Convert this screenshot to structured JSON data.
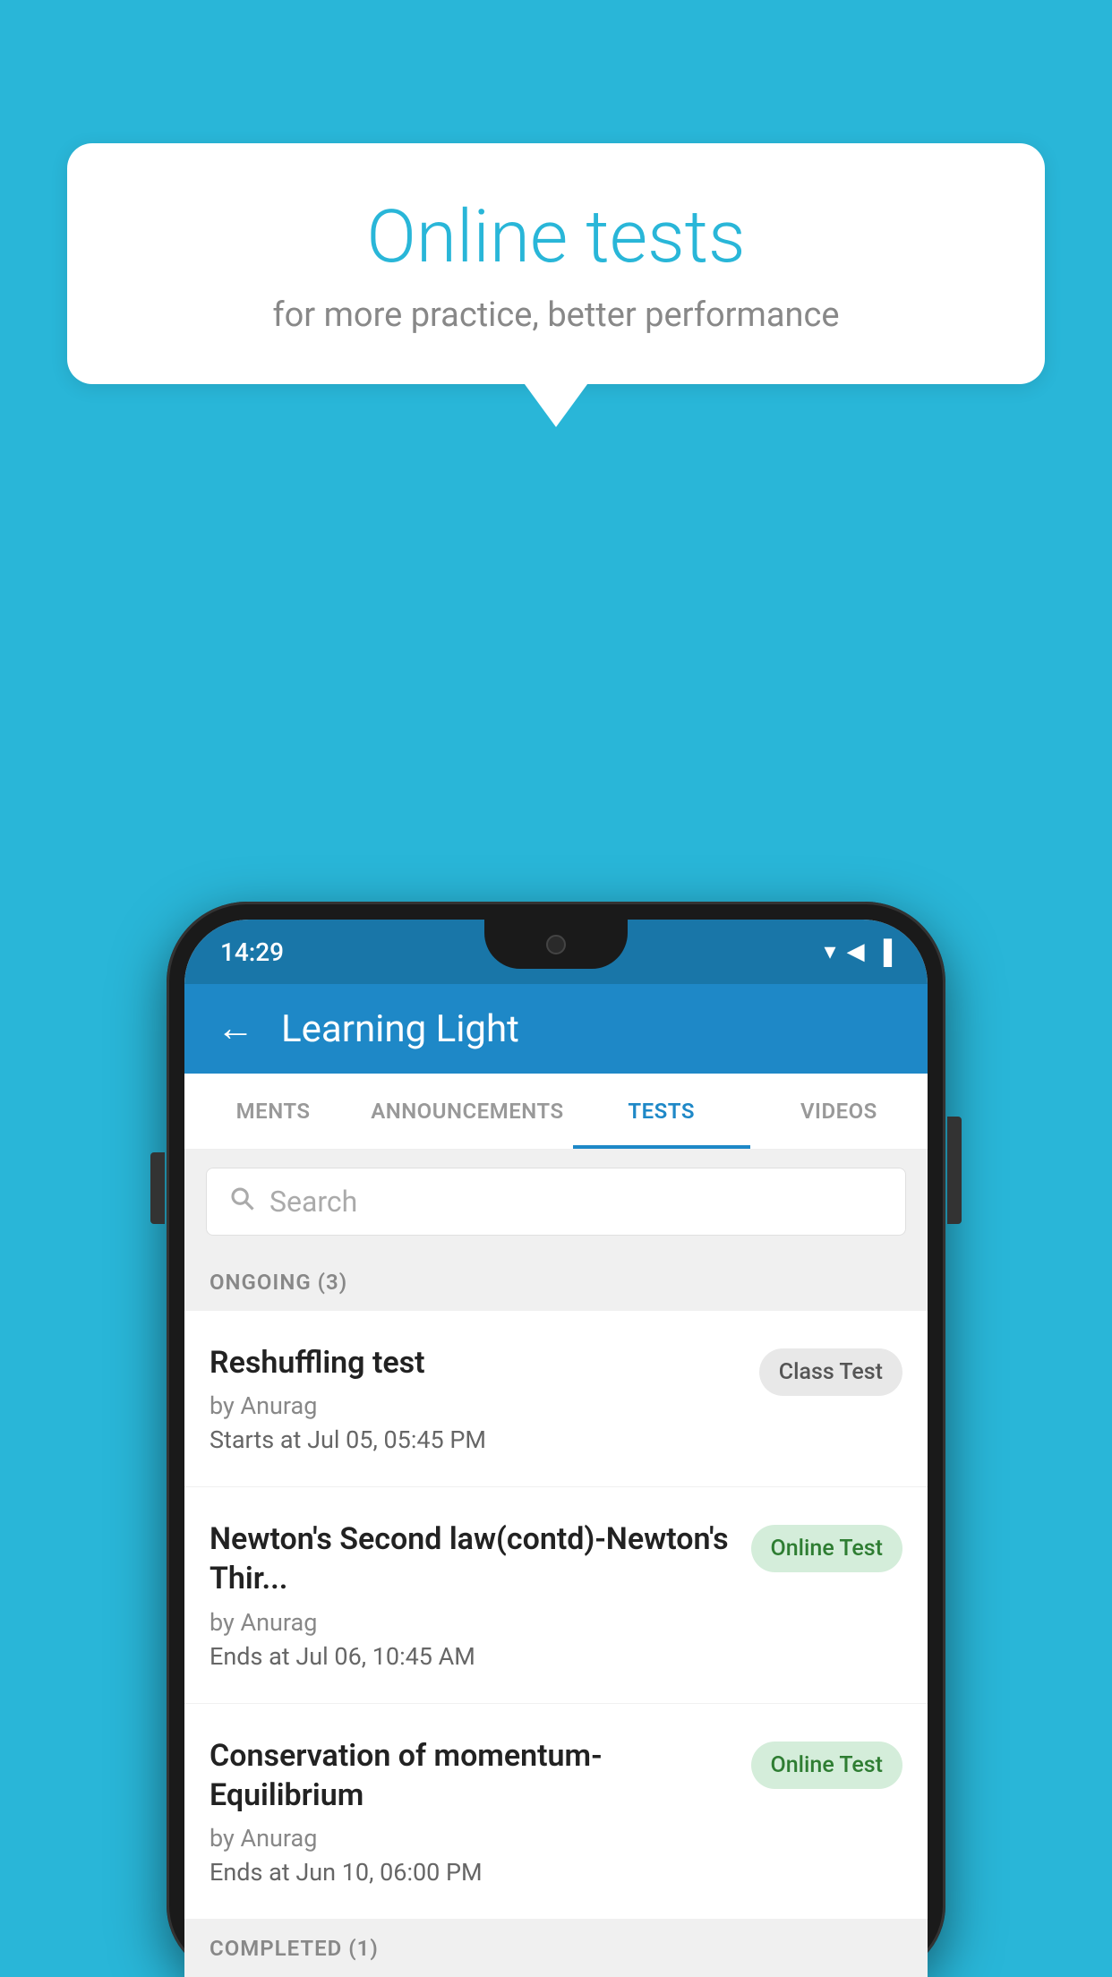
{
  "background_color": "#29B6D8",
  "speech_bubble": {
    "title": "Online tests",
    "subtitle": "for more practice, better performance"
  },
  "phone": {
    "status_bar": {
      "time": "14:29",
      "wifi": "▼",
      "signal": "▲",
      "battery": "▮"
    },
    "header": {
      "back_label": "←",
      "title": "Learning Light"
    },
    "tabs": [
      {
        "label": "MENTS",
        "active": false
      },
      {
        "label": "ANNOUNCEMENTS",
        "active": false
      },
      {
        "label": "TESTS",
        "active": true
      },
      {
        "label": "VIDEOS",
        "active": false
      }
    ],
    "search": {
      "placeholder": "Search"
    },
    "section_ongoing": {
      "label": "ONGOING (3)"
    },
    "tests": [
      {
        "name": "Reshuffling test",
        "by": "by Anurag",
        "time_label": "Starts at",
        "time": "Jul 05, 05:45 PM",
        "badge": "Class Test",
        "badge_type": "class"
      },
      {
        "name": "Newton's Second law(contd)-Newton's Thir...",
        "by": "by Anurag",
        "time_label": "Ends at",
        "time": "Jul 06, 10:45 AM",
        "badge": "Online Test",
        "badge_type": "online"
      },
      {
        "name": "Conservation of momentum-Equilibrium",
        "by": "by Anurag",
        "time_label": "Ends at",
        "time": "Jun 10, 06:00 PM",
        "badge": "Online Test",
        "badge_type": "online"
      }
    ],
    "section_completed": {
      "label": "COMPLETED (1)"
    }
  }
}
